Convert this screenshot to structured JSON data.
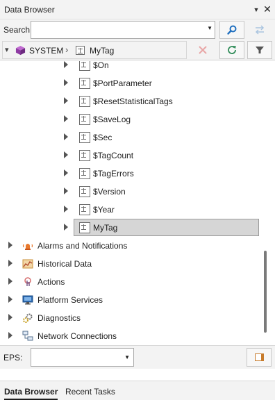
{
  "panel": {
    "title": "Data Browser",
    "pin_icon": "▼",
    "close_icon": "✕"
  },
  "search": {
    "label": "Search:",
    "value": "",
    "placeholder": "",
    "dropdown_icon": "▼"
  },
  "breadcrumb": {
    "items": [
      "SYSTEM",
      "MyTag"
    ],
    "separator": "›",
    "expand_icon": "▾"
  },
  "tree": {
    "tags": [
      "$On",
      "$PortParameter",
      "$ResetStatisticalTags",
      "$SaveLog",
      "$Sec",
      "$TagCount",
      "$TagErrors",
      "$Version",
      "$Year",
      "MyTag"
    ],
    "selected": "MyTag",
    "root_nodes": [
      {
        "label": "Alarms and Notifications",
        "icon": "alarm-icon"
      },
      {
        "label": "Historical Data",
        "icon": "historical-chart-icon"
      },
      {
        "label": "Actions",
        "icon": "actions-icon"
      },
      {
        "label": "Platform Services",
        "icon": "platform-services-icon"
      },
      {
        "label": "Diagnostics",
        "icon": "diagnostics-gears-icon"
      },
      {
        "label": "Network Connections",
        "icon": "network-icon"
      }
    ]
  },
  "eps": {
    "label": "EPS:",
    "value": "",
    "dropdown_icon": "▼"
  },
  "tabs": [
    "Data Browser",
    "Recent Tasks"
  ],
  "colors": {
    "accent_blue": "#1f6fbf",
    "refresh_green": "#2e8b57",
    "delete_red": "#d23c3c",
    "selection": "#d6d6d6"
  }
}
